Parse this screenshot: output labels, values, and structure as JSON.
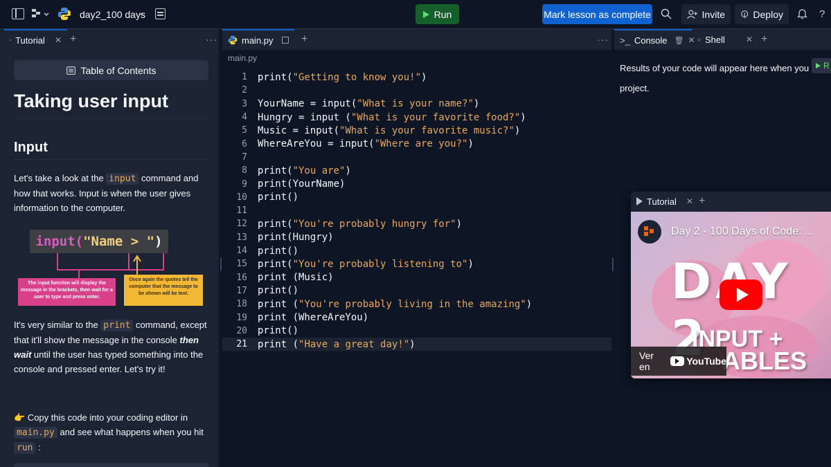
{
  "topbar": {
    "repl_name": "day2_100 days",
    "run_label": "Run",
    "mark_complete_label": "Mark lesson as complete",
    "invite_label": "Invite",
    "deploy_label": "Deploy",
    "help_label": "?"
  },
  "tutorial": {
    "tab_label": "Tutorial",
    "toc_label": "Table of Contents",
    "title": "Taking user input",
    "section_title": "Input",
    "p1_a": "Let's take a look at the ",
    "p1_code": "input",
    "p1_b": " command and how that works. Input is when the user gives information to the computer.",
    "diagram": {
      "code_fn": "input(",
      "code_str": "\"Name > \"",
      "code_close": ")",
      "left_note": "The input function will display the message in the brackets, then wait for a user to type and press enter.",
      "right_note": "Once again the quotes tell the computer that the message to be shown will be text."
    },
    "p2_a": "It's very similar to the ",
    "p2_code": "print",
    "p2_b": " command, except that it'll show the message in the console ",
    "p2_em": "then wait",
    "p2_c": " until the user has typed something into the console and pressed enter. Let's try it!",
    "p3_emoji": "👉",
    "p3_a": " Copy this code into your coding editor in ",
    "p3_code1": "main.py",
    "p3_b": " and see what happens when you hit ",
    "p3_code2": "run",
    "p3_c": " :"
  },
  "editor": {
    "tab_label": "main.py",
    "breadcrumb": "main.py",
    "active_line": 21,
    "lines": [
      {
        "n": "1",
        "code": "print(\"Getting to know you!\")"
      },
      {
        "n": "2",
        "code": ""
      },
      {
        "n": "3",
        "code": "YourName = input(\"What is your name?\")"
      },
      {
        "n": "4",
        "code": "Hungry = input (\"What is your favorite food?\")"
      },
      {
        "n": "5",
        "code": "Music = input(\"What is your favorite music?\")"
      },
      {
        "n": "6",
        "code": "WhereAreYou = input(\"Where are you?\")"
      },
      {
        "n": "7",
        "code": ""
      },
      {
        "n": "8",
        "code": "print(\"You are\")"
      },
      {
        "n": "9",
        "code": "print(YourName)"
      },
      {
        "n": "10",
        "code": "print()"
      },
      {
        "n": "11",
        "code": ""
      },
      {
        "n": "12",
        "code": "print(\"You're probably hungry for\")"
      },
      {
        "n": "13",
        "code": "print(Hungry)"
      },
      {
        "n": "14",
        "code": "print()"
      },
      {
        "n": "15",
        "code": "print(\"You're probably listening to\")"
      },
      {
        "n": "16",
        "code": "print (Music)"
      },
      {
        "n": "17",
        "code": "print()"
      },
      {
        "n": "18",
        "code": "print (\"You're probably living in the amazing\")"
      },
      {
        "n": "19",
        "code": "print (WhereAreYou)"
      },
      {
        "n": "20",
        "code": "print()"
      },
      {
        "n": "21",
        "code": "print (\"Have a great day!\")"
      }
    ]
  },
  "console": {
    "tab_label": "Console",
    "shell_tab_label": "Shell",
    "message_line1": "Results of your code will appear here when you",
    "message_line2": "project.",
    "mini_run_label": "R"
  },
  "floating_tutorial": {
    "tab_label": "Tutorial",
    "video_title": "Day 2 - 100 Days of Code: ...",
    "thumb_big": "DAY 2",
    "thumb_sub1": "INPUT +",
    "thumb_sub2": "ABLES",
    "watch_on": "Ver en",
    "yt_label": "YouTube"
  },
  "colors": {
    "bg": "#0e1525",
    "panel": "#1c2333",
    "accent_blue": "#0f62cf",
    "run_green": "#15602a",
    "code_string": "#e8a85a"
  }
}
